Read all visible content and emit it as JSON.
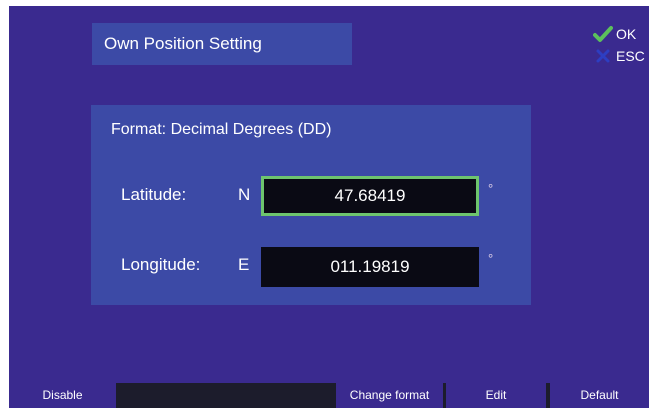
{
  "header": {
    "title": "Own Position Setting"
  },
  "actions": {
    "ok_label": "OK",
    "esc_label": "ESC"
  },
  "position": {
    "format_label": "Format: Decimal Degrees (DD)",
    "latitude": {
      "label": "Latitude:",
      "hemisphere": "N",
      "value": "47.68419",
      "unit": "°"
    },
    "longitude": {
      "label": "Longitude:",
      "hemisphere": "E",
      "value": "011.19819",
      "unit": "°"
    }
  },
  "softkeys": {
    "disable": "Disable",
    "change_format": "Change format",
    "edit": "Edit",
    "default": "Default"
  },
  "colors": {
    "background": "#3a2a8f",
    "panel": "#3c4aa6",
    "active_border": "#6ec56e",
    "ok_check": "#5cc05c",
    "esc_x": "#2d3ec2"
  }
}
